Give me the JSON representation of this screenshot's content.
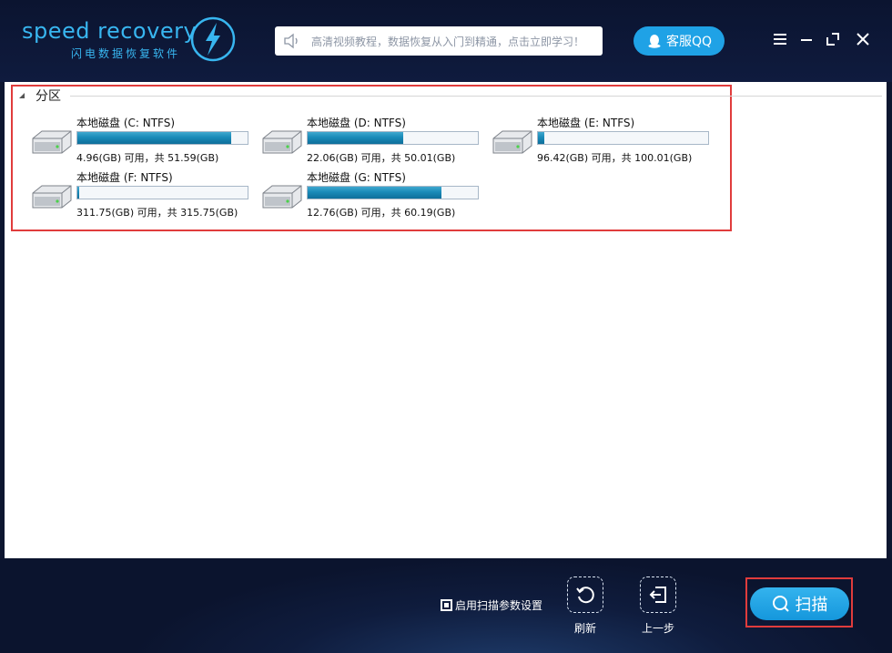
{
  "brand": {
    "name": "speed recovery",
    "subtitle": "闪电数据恢复软件",
    "accent_color": "#38b6f0"
  },
  "header": {
    "notice_text": "高清视频教程，数据恢复从入门到精通，点击立即学习！",
    "qq_button_label": "客服QQ",
    "window_controls": [
      "menu-icon",
      "minimize-icon",
      "maximize-icon",
      "close-icon"
    ]
  },
  "partitions": {
    "section_title": "分区",
    "drives": [
      {
        "name": "本地磁盘 (C: NTFS)",
        "space": "4.96(GB) 可用，共 51.59(GB)",
        "used_fraction": 0.904
      },
      {
        "name": "本地磁盘 (D: NTFS)",
        "space": "22.06(GB) 可用，共 50.01(GB)",
        "used_fraction": 0.559
      },
      {
        "name": "本地磁盘 (E: NTFS)",
        "space": "96.42(GB) 可用，共 100.01(GB)",
        "used_fraction": 0.036
      },
      {
        "name": "本地磁盘 (F: NTFS)",
        "space": "311.75(GB) 可用，共 315.75(GB)",
        "used_fraction": 0.013
      },
      {
        "name": "本地磁盘 (G: NTFS)",
        "space": "12.76(GB) 可用，共 60.19(GB)",
        "used_fraction": 0.788
      }
    ]
  },
  "footer": {
    "scan_setting_label": "启用扫描参数设置",
    "refresh_label": "刷新",
    "back_label": "上一步",
    "scan_label": "扫描"
  },
  "colors": {
    "highlight": "#e03c3c",
    "bar_fill": "#1a8ab8",
    "scan_button": "#1fa2e6"
  }
}
